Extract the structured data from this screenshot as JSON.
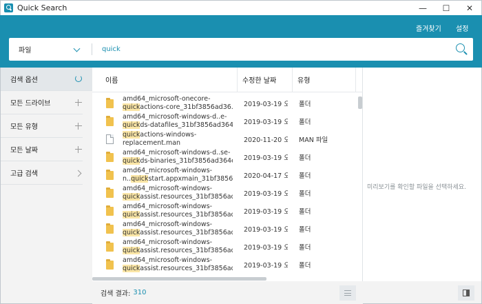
{
  "window": {
    "title": "Quick Search",
    "controls": [
      "—",
      "☐",
      "✕"
    ]
  },
  "header": {
    "favorites": "즐겨찾기",
    "settings": "설정"
  },
  "search": {
    "scope": "파일",
    "query": "quick"
  },
  "sidebar": {
    "items": [
      {
        "label": "검색 옵션",
        "icon": "refresh-icon"
      },
      {
        "label": "모든 드라이브",
        "icon": "plus-icon"
      },
      {
        "label": "모든 유형",
        "icon": "plus-icon"
      },
      {
        "label": "모든 날짜",
        "icon": "plus-icon"
      },
      {
        "label": "고급 검색",
        "icon": "chevron-right-icon"
      }
    ]
  },
  "columns": {
    "name": "이름",
    "modified": "수정한 날짜",
    "type": "유형"
  },
  "files": [
    {
      "kind": "folder",
      "line1": [
        "amd64_microsoft-onecore-",
        "",
        ""
      ],
      "line2": [
        "",
        "quick",
        "actions-core_31bf3856ad36..."
      ],
      "date": "2019-03-19 오...",
      "type": "폴더"
    },
    {
      "kind": "folder",
      "line1": [
        "amd64_microsoft-windows-d..e-",
        "",
        ""
      ],
      "line2": [
        "",
        "quick",
        "ds-datafiles_31bf3856ad364..."
      ],
      "date": "2019-03-19 오...",
      "type": "폴더"
    },
    {
      "kind": "file",
      "line1": [
        "",
        "quick",
        "actions-windows-"
      ],
      "line2": [
        "replacement.man",
        "",
        ""
      ],
      "date": "2020-11-20 오...",
      "type": "MAN 파일"
    },
    {
      "kind": "folder",
      "line1": [
        "amd64_microsoft-windows-d..se-",
        "",
        ""
      ],
      "line2": [
        "",
        "quick",
        "ds-binaries_31bf3856ad364e..."
      ],
      "date": "2019-03-19 오...",
      "type": "폴더"
    },
    {
      "kind": "folder",
      "line1": [
        "amd64_microsoft-windows-",
        "",
        ""
      ],
      "line2": [
        "n..",
        "quick",
        "start.appxmain_31bf3856..."
      ],
      "date": "2020-04-17 오...",
      "type": "폴더"
    },
    {
      "kind": "folder",
      "line1": [
        "amd64_microsoft-windows-",
        "",
        ""
      ],
      "line2": [
        "",
        "quick",
        "assist.resources_31bf3856ad..."
      ],
      "date": "2019-03-19 오...",
      "type": "폴더"
    },
    {
      "kind": "folder",
      "line1": [
        "amd64_microsoft-windows-",
        "",
        ""
      ],
      "line2": [
        "",
        "quick",
        "assist.resources_31bf3856ad..."
      ],
      "date": "2019-03-19 오...",
      "type": "폴더"
    },
    {
      "kind": "folder",
      "line1": [
        "amd64_microsoft-windows-",
        "",
        ""
      ],
      "line2": [
        "",
        "quick",
        "assist.resources_31bf3856ad..."
      ],
      "date": "2019-03-19 오...",
      "type": "폴더"
    },
    {
      "kind": "folder",
      "line1": [
        "amd64_microsoft-windows-",
        "",
        ""
      ],
      "line2": [
        "",
        "quick",
        "assist.resources_31bf3856ad..."
      ],
      "date": "2019-03-19 오...",
      "type": "폴더"
    },
    {
      "kind": "folder",
      "line1": [
        "amd64_microsoft-windows-",
        "",
        ""
      ],
      "line2": [
        "",
        "quick",
        "assist.resources_31bf3856ad..."
      ],
      "date": "2019-03-19 오...",
      "type": "폴더"
    }
  ],
  "footer": {
    "result_label": "검색 결과:",
    "result_count": "310"
  },
  "preview": {
    "message": "미리보기를 확인할 파일을 선택하세요."
  },
  "colors": {
    "accent": "#1a8fb0",
    "highlight": "#fbe6a6"
  }
}
